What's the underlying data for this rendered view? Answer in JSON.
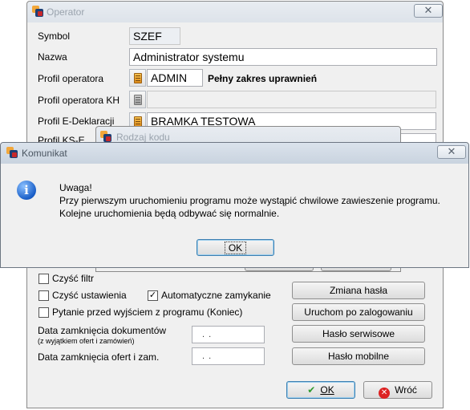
{
  "operator": {
    "title": "Operator",
    "close": "✕",
    "labels": {
      "symbol": "Symbol",
      "nazwa": "Nazwa",
      "profil_operatora": "Profil operatora",
      "profil_operatora_kh": "Profil operatora KH",
      "profil_edeklaracji": "Profil E-Deklaracji",
      "profil_kse_partial": "Profil KS-E",
      "czysc_filtry_partial": "Czyść filtr",
      "czysc_ustawienia": "Czyść ustawienia",
      "automatyczne_zamykanie": "Automatyczne zamykanie",
      "pytanie": "Pytanie przed wyjściem z programu (Koniec)",
      "data_zamkniecia_dok": "Data zamknięcia dokumentów",
      "data_zamkniecia_dok_sub": "(z wyjątkiem ofert i zamówień)",
      "data_zamkniecia_ofert": "Data zamknięcia ofert i zam."
    },
    "values": {
      "symbol": "SZEF",
      "nazwa": "Administrator systemu",
      "profil_operatora": "ADMIN",
      "profil_operatora_desc": "Pełny zakres uprawnień",
      "profil_operatora_kh": "",
      "profil_edeklaracji": "BRAMKA TESTOWA",
      "data_dok": ". .",
      "data_ofert": ". ."
    },
    "checkboxes": {
      "czysc_filtry": false,
      "czysc_ustawienia": false,
      "automatyczne_zamykanie": true,
      "pytanie": false
    },
    "buttons": {
      "zmiana_hasla": "Zmiana hasła",
      "uruchom": "Uruchom po zalogowaniu",
      "haslo_serwisowe": "Hasło serwisowe",
      "haslo_mobilne": "Hasło mobilne",
      "ok": "OK",
      "wroc": "Wróć"
    },
    "checkmark": "✓"
  },
  "rodzaj_kodu": {
    "title": "Rodzaj kodu"
  },
  "komunikat": {
    "title": "Komunikat",
    "close": "✕",
    "icon": "i",
    "heading": "Uwaga!",
    "line1": "Przy pierwszym uruchomieniu programu może wystąpić chwilowe zawieszenie programu.",
    "line2": "Kolejne uruchomienia będą odbywać się normalnie.",
    "ok": "OK"
  }
}
